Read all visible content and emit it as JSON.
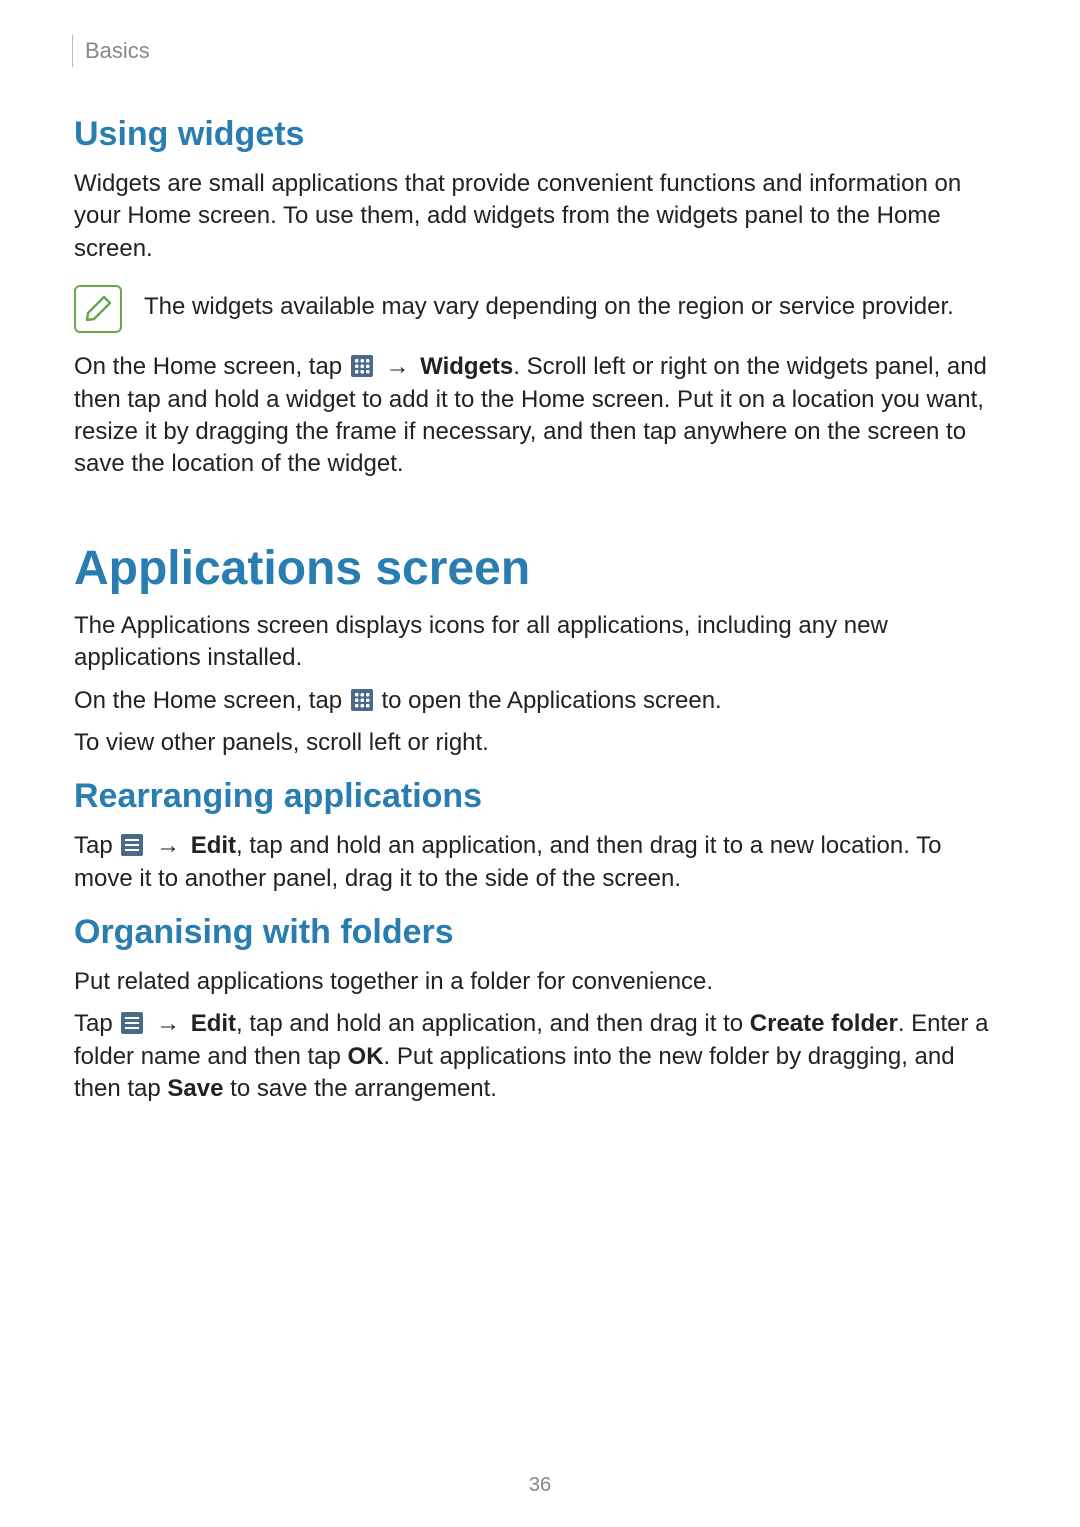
{
  "header": {
    "section_label": "Basics"
  },
  "using_widgets": {
    "title": "Using widgets",
    "intro": "Widgets are small applications that provide convenient functions and information on your Home screen. To use them, add widgets from the widgets panel to the Home screen.",
    "note": "The widgets available may vary depending on the region or service provider.",
    "instr_prefix": "On the Home screen, tap ",
    "arrow": "→",
    "widgets_label": "Widgets",
    "instr_suffix": ". Scroll left or right on the widgets panel, and then tap and hold a widget to add it to the Home screen. Put it on a location you want, resize it by dragging the frame if necessary, and then tap anywhere on the screen to save the location of the widget."
  },
  "apps_screen": {
    "title": "Applications screen",
    "p1": "The Applications screen displays icons for all applications, including any new applications installed.",
    "p2_prefix": "On the Home screen, tap ",
    "p2_suffix": " to open the Applications screen.",
    "p3": "To view other panels, scroll left or right."
  },
  "rearranging": {
    "title": "Rearranging applications",
    "prefix": "Tap ",
    "arrow": "→",
    "edit_label": "Edit",
    "suffix": ", tap and hold an application, and then drag it to a new location. To move it to another panel, drag it to the side of the screen."
  },
  "organising": {
    "title": "Organising with folders",
    "p1": "Put related applications together in a folder for convenience.",
    "p2_prefix": "Tap ",
    "arrow": "→",
    "edit_label": "Edit",
    "p2_mid1": ", tap and hold an application, and then drag it to ",
    "create_folder": "Create folder",
    "p2_mid2": ". Enter a folder name and then tap ",
    "ok_label": "OK",
    "p2_mid3": ". Put applications into the new folder by dragging, and then tap ",
    "save_label": "Save",
    "p2_suffix": " to save the arrangement."
  },
  "page_number": "36"
}
